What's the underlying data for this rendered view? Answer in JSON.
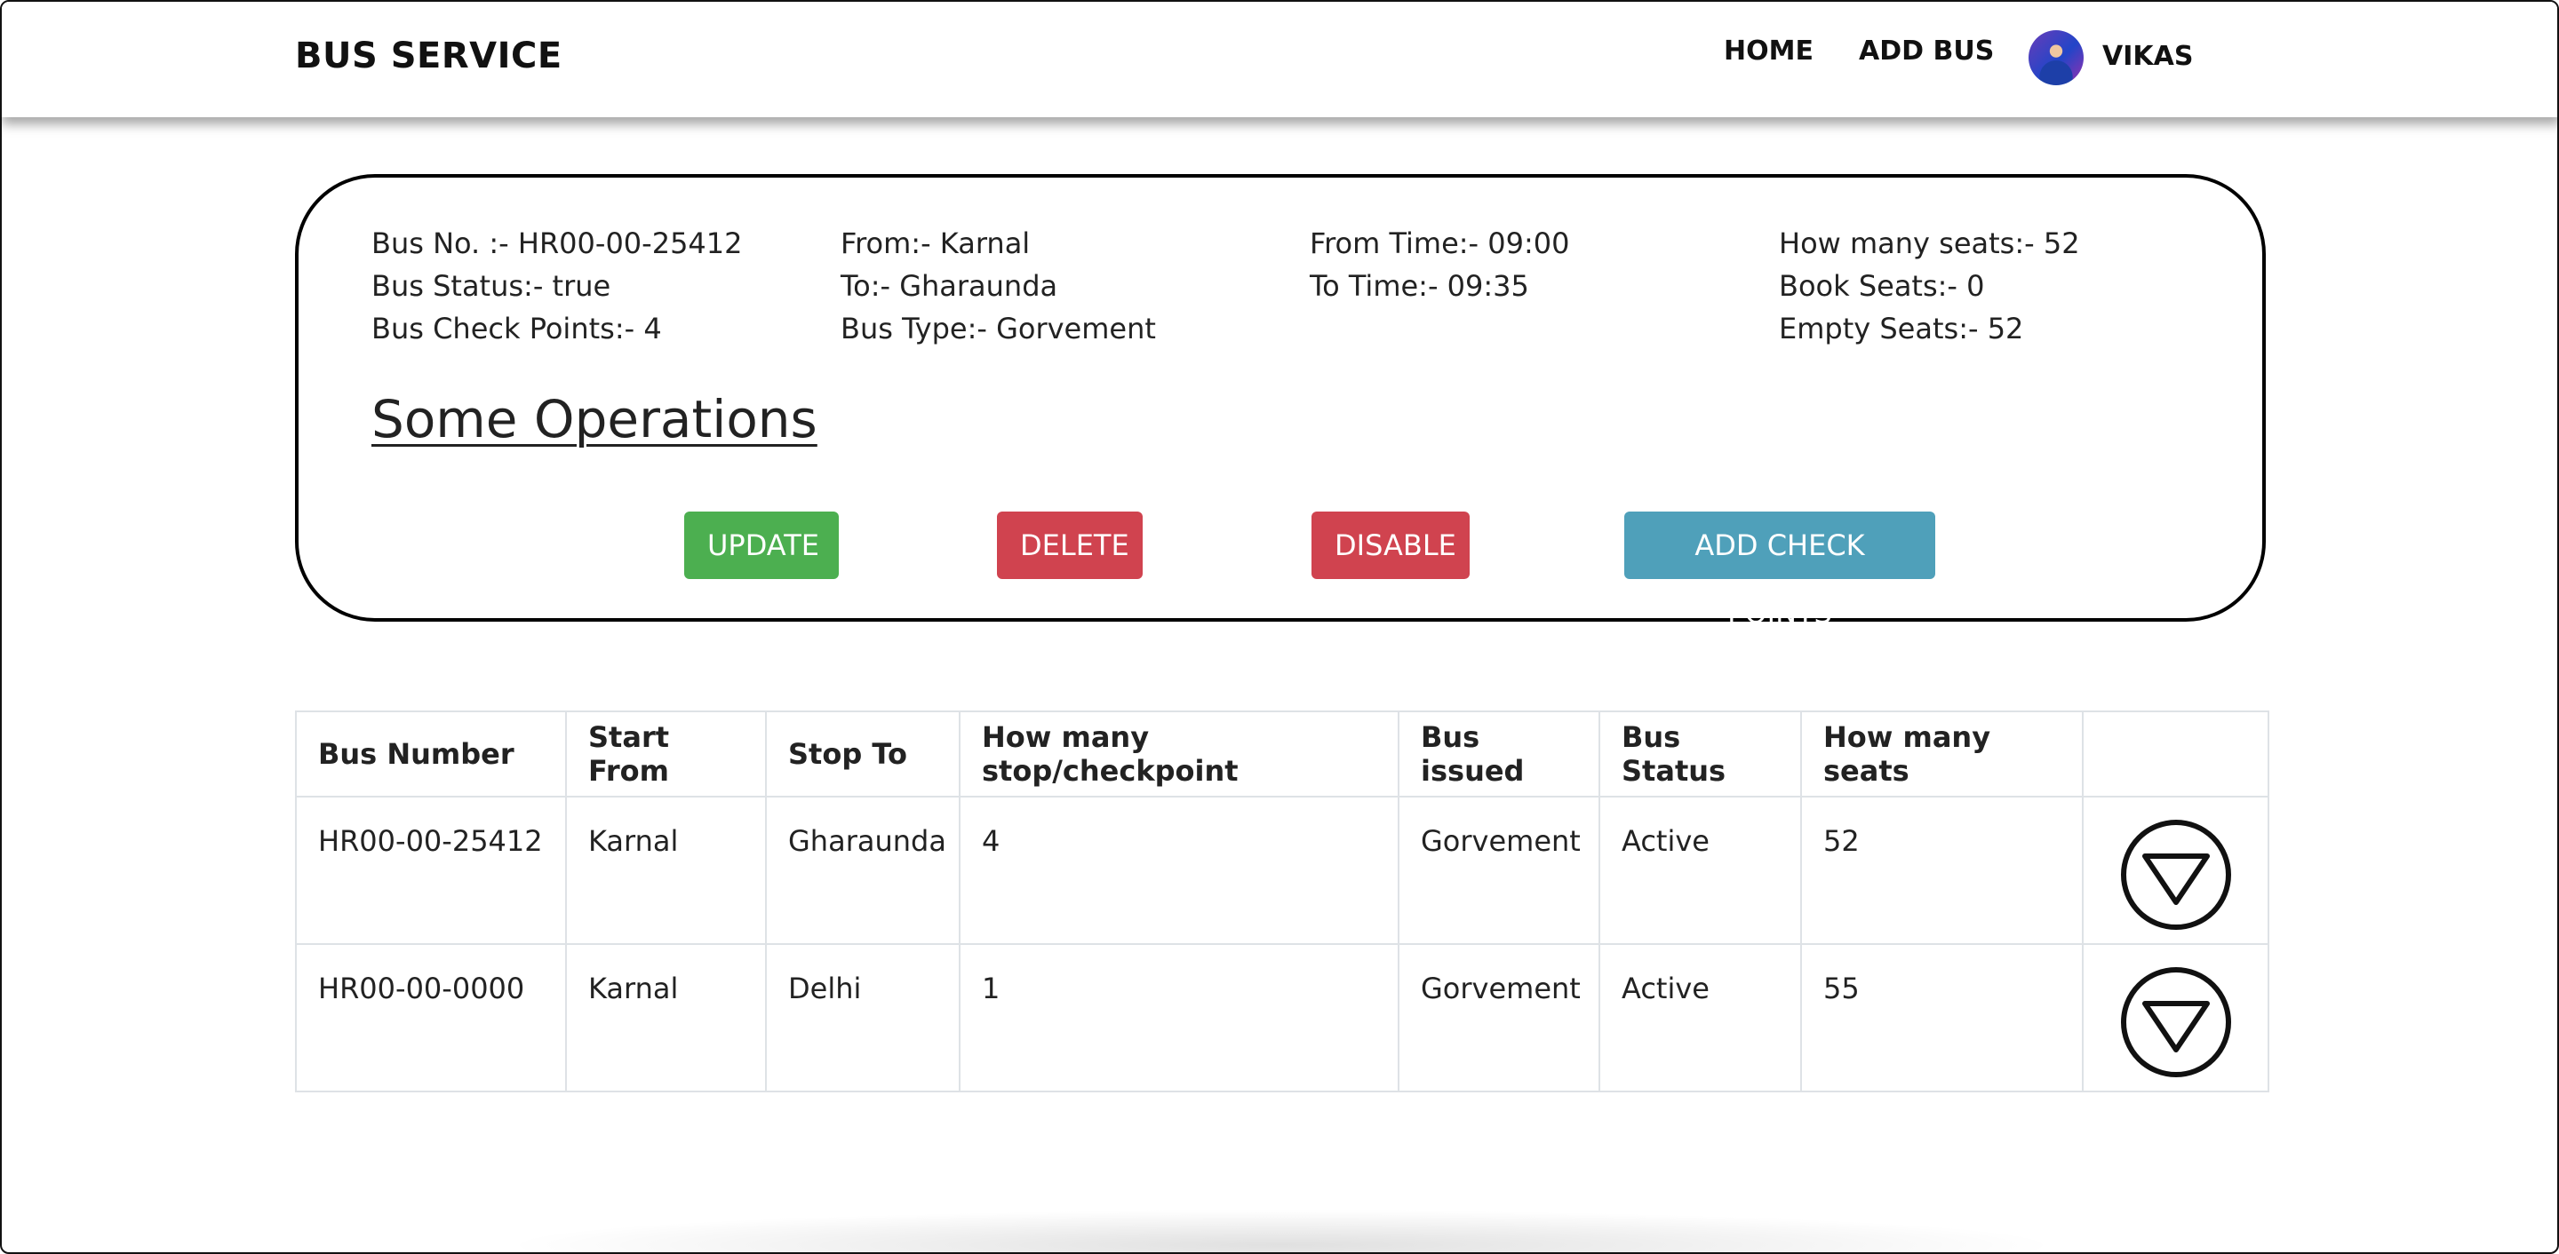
{
  "navbar": {
    "brand": "BUS SERVICE",
    "links": [
      {
        "label": "HOME"
      },
      {
        "label": "ADD BUS"
      }
    ],
    "user": {
      "name": "VIKAS"
    }
  },
  "details": {
    "bus_no": "Bus No. :- HR00-00-25412",
    "bus_status": "Bus Status:- true",
    "check_points": "Bus Check Points:- 4",
    "from": "From:- Karnal",
    "to": "To:- Gharaunda",
    "bus_type": "Bus Type:- Gorvement",
    "from_time": "From Time:- 09:00",
    "to_time": "To Time:- 09:35",
    "seats": "How many seats:- 52",
    "book_seats": "Book Seats:- 0",
    "empty_seats": "Empty Seats:- 52"
  },
  "operations": {
    "title": "Some Operations",
    "buttons": {
      "update": "UPDATE",
      "delete": "DELETE",
      "disable": "DISABLE",
      "add_check_points": "ADD CHECK POINTS"
    },
    "colors": {
      "update": "#4caf50",
      "delete": "#d0434f",
      "disable": "#d0434f",
      "add_check_points": "#4fa0ba"
    }
  },
  "table": {
    "headers": [
      "Bus Number",
      "Start From",
      "Stop To",
      "How many stop/checkpoint",
      "Bus issued",
      "Bus Status",
      "How many seats",
      ""
    ],
    "rows": [
      {
        "bus_number": "HR00-00-25412",
        "start_from": "Karnal",
        "stop_to": "Gharaunda",
        "stops": "4",
        "issued": "Gorvement",
        "status": "Active",
        "seats": "52",
        "action_icon": "triangle-down-circle-icon"
      },
      {
        "bus_number": "HR00-00-0000",
        "start_from": "Karnal",
        "stop_to": "Delhi",
        "stops": "1",
        "issued": "Gorvement",
        "status": "Active",
        "seats": "55",
        "action_icon": "triangle-down-circle-icon"
      }
    ]
  }
}
